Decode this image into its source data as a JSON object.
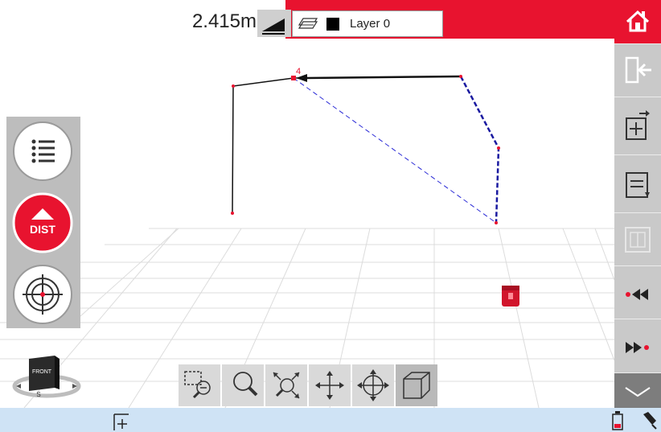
{
  "top_bar": {
    "distance": "2.415m",
    "layer_name": "Layer 0",
    "accent_color": "#e8132f"
  },
  "scene": {
    "point_label": "4"
  },
  "left_panel": {
    "dist_label": "DIST"
  },
  "view_cube": {
    "face_label": "FRONT",
    "compass_label": "S"
  },
  "right_bar": {
    "items": [
      {
        "icon": "home-icon"
      },
      {
        "icon": "exit-icon"
      },
      {
        "icon": "add-list-icon"
      },
      {
        "icon": "list-download-icon"
      },
      {
        "icon": "frame-icon"
      },
      {
        "icon": "step-back-icon"
      },
      {
        "icon": "step-forward-icon"
      },
      {
        "icon": "chevron-down-icon"
      }
    ]
  },
  "bottom_toolbar": {
    "items": [
      {
        "icon": "zoom-window-icon"
      },
      {
        "icon": "zoom-icon"
      },
      {
        "icon": "zoom-extents-icon"
      },
      {
        "icon": "pan-icon"
      },
      {
        "icon": "orbit-icon"
      },
      {
        "icon": "cube-view-icon"
      }
    ]
  }
}
